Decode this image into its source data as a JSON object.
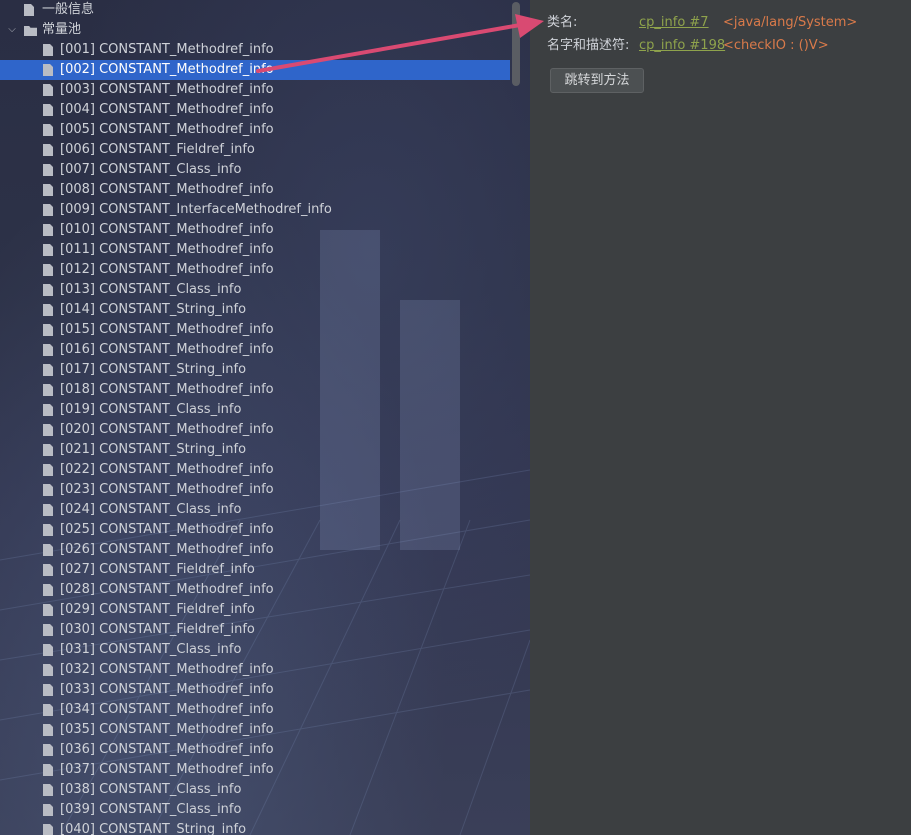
{
  "tree": {
    "root_items": [
      {
        "label": "一般信息",
        "icon": "file-icon",
        "expandable": false
      },
      {
        "label": "常量池",
        "icon": "folder-icon",
        "expandable": true,
        "expanded": true
      }
    ],
    "selected_index": 1,
    "constant_pool": [
      "[001] CONSTANT_Methodref_info",
      "[002] CONSTANT_Methodref_info",
      "[003] CONSTANT_Methodref_info",
      "[004] CONSTANT_Methodref_info",
      "[005] CONSTANT_Methodref_info",
      "[006] CONSTANT_Fieldref_info",
      "[007] CONSTANT_Class_info",
      "[008] CONSTANT_Methodref_info",
      "[009] CONSTANT_InterfaceMethodref_info",
      "[010] CONSTANT_Methodref_info",
      "[011] CONSTANT_Methodref_info",
      "[012] CONSTANT_Methodref_info",
      "[013] CONSTANT_Class_info",
      "[014] CONSTANT_String_info",
      "[015] CONSTANT_Methodref_info",
      "[016] CONSTANT_Methodref_info",
      "[017] CONSTANT_String_info",
      "[018] CONSTANT_Methodref_info",
      "[019] CONSTANT_Class_info",
      "[020] CONSTANT_Methodref_info",
      "[021] CONSTANT_String_info",
      "[022] CONSTANT_Methodref_info",
      "[023] CONSTANT_Methodref_info",
      "[024] CONSTANT_Class_info",
      "[025] CONSTANT_Methodref_info",
      "[026] CONSTANT_Methodref_info",
      "[027] CONSTANT_Fieldref_info",
      "[028] CONSTANT_Methodref_info",
      "[029] CONSTANT_Fieldref_info",
      "[030] CONSTANT_Fieldref_info",
      "[031] CONSTANT_Class_info",
      "[032] CONSTANT_Methodref_info",
      "[033] CONSTANT_Methodref_info",
      "[034] CONSTANT_Methodref_info",
      "[035] CONSTANT_Methodref_info",
      "[036] CONSTANT_Methodref_info",
      "[037] CONSTANT_Methodref_info",
      "[038] CONSTANT_Class_info",
      "[039] CONSTANT_Class_info",
      "[040] CONSTANT_String_info"
    ]
  },
  "detail": {
    "class_name": {
      "label": "类名:",
      "link": "cp_info #7",
      "value": "<java/lang/System>"
    },
    "name_and_type": {
      "label": "名字和描述符:",
      "link": "cp_info #198",
      "value": "<checkIO : ()V>"
    },
    "jump_button": "跳转到方法"
  },
  "colors": {
    "selection": "#2f65ca",
    "link": "#8fa34c",
    "value": "#d97a4a",
    "arrow": "#d94a72",
    "panel": "#3c3f41"
  }
}
